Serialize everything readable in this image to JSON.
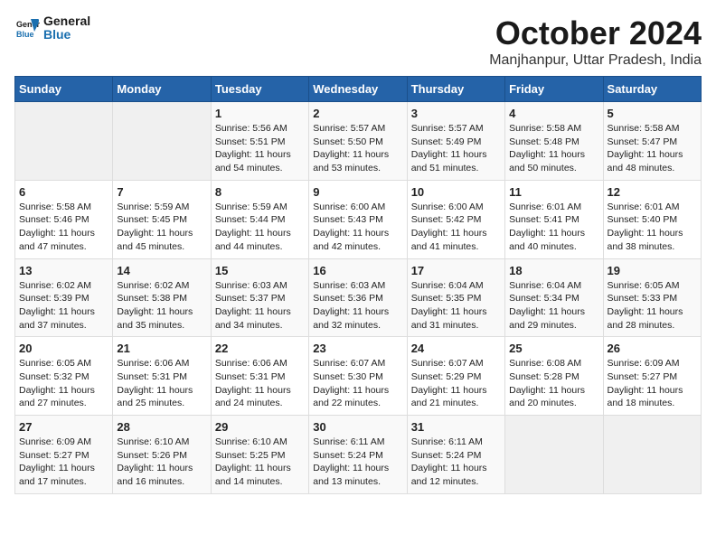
{
  "logo": {
    "line1": "General",
    "line2": "Blue"
  },
  "title": "October 2024",
  "subtitle": "Manjhanpur, Uttar Pradesh, India",
  "days_of_week": [
    "Sunday",
    "Monday",
    "Tuesday",
    "Wednesday",
    "Thursday",
    "Friday",
    "Saturday"
  ],
  "weeks": [
    [
      {
        "day": "",
        "content": ""
      },
      {
        "day": "",
        "content": ""
      },
      {
        "day": "1",
        "content": "Sunrise: 5:56 AM\nSunset: 5:51 PM\nDaylight: 11 hours\nand 54 minutes."
      },
      {
        "day": "2",
        "content": "Sunrise: 5:57 AM\nSunset: 5:50 PM\nDaylight: 11 hours\nand 53 minutes."
      },
      {
        "day": "3",
        "content": "Sunrise: 5:57 AM\nSunset: 5:49 PM\nDaylight: 11 hours\nand 51 minutes."
      },
      {
        "day": "4",
        "content": "Sunrise: 5:58 AM\nSunset: 5:48 PM\nDaylight: 11 hours\nand 50 minutes."
      },
      {
        "day": "5",
        "content": "Sunrise: 5:58 AM\nSunset: 5:47 PM\nDaylight: 11 hours\nand 48 minutes."
      }
    ],
    [
      {
        "day": "6",
        "content": "Sunrise: 5:58 AM\nSunset: 5:46 PM\nDaylight: 11 hours\nand 47 minutes."
      },
      {
        "day": "7",
        "content": "Sunrise: 5:59 AM\nSunset: 5:45 PM\nDaylight: 11 hours\nand 45 minutes."
      },
      {
        "day": "8",
        "content": "Sunrise: 5:59 AM\nSunset: 5:44 PM\nDaylight: 11 hours\nand 44 minutes."
      },
      {
        "day": "9",
        "content": "Sunrise: 6:00 AM\nSunset: 5:43 PM\nDaylight: 11 hours\nand 42 minutes."
      },
      {
        "day": "10",
        "content": "Sunrise: 6:00 AM\nSunset: 5:42 PM\nDaylight: 11 hours\nand 41 minutes."
      },
      {
        "day": "11",
        "content": "Sunrise: 6:01 AM\nSunset: 5:41 PM\nDaylight: 11 hours\nand 40 minutes."
      },
      {
        "day": "12",
        "content": "Sunrise: 6:01 AM\nSunset: 5:40 PM\nDaylight: 11 hours\nand 38 minutes."
      }
    ],
    [
      {
        "day": "13",
        "content": "Sunrise: 6:02 AM\nSunset: 5:39 PM\nDaylight: 11 hours\nand 37 minutes."
      },
      {
        "day": "14",
        "content": "Sunrise: 6:02 AM\nSunset: 5:38 PM\nDaylight: 11 hours\nand 35 minutes."
      },
      {
        "day": "15",
        "content": "Sunrise: 6:03 AM\nSunset: 5:37 PM\nDaylight: 11 hours\nand 34 minutes."
      },
      {
        "day": "16",
        "content": "Sunrise: 6:03 AM\nSunset: 5:36 PM\nDaylight: 11 hours\nand 32 minutes."
      },
      {
        "day": "17",
        "content": "Sunrise: 6:04 AM\nSunset: 5:35 PM\nDaylight: 11 hours\nand 31 minutes."
      },
      {
        "day": "18",
        "content": "Sunrise: 6:04 AM\nSunset: 5:34 PM\nDaylight: 11 hours\nand 29 minutes."
      },
      {
        "day": "19",
        "content": "Sunrise: 6:05 AM\nSunset: 5:33 PM\nDaylight: 11 hours\nand 28 minutes."
      }
    ],
    [
      {
        "day": "20",
        "content": "Sunrise: 6:05 AM\nSunset: 5:32 PM\nDaylight: 11 hours\nand 27 minutes."
      },
      {
        "day": "21",
        "content": "Sunrise: 6:06 AM\nSunset: 5:31 PM\nDaylight: 11 hours\nand 25 minutes."
      },
      {
        "day": "22",
        "content": "Sunrise: 6:06 AM\nSunset: 5:31 PM\nDaylight: 11 hours\nand 24 minutes."
      },
      {
        "day": "23",
        "content": "Sunrise: 6:07 AM\nSunset: 5:30 PM\nDaylight: 11 hours\nand 22 minutes."
      },
      {
        "day": "24",
        "content": "Sunrise: 6:07 AM\nSunset: 5:29 PM\nDaylight: 11 hours\nand 21 minutes."
      },
      {
        "day": "25",
        "content": "Sunrise: 6:08 AM\nSunset: 5:28 PM\nDaylight: 11 hours\nand 20 minutes."
      },
      {
        "day": "26",
        "content": "Sunrise: 6:09 AM\nSunset: 5:27 PM\nDaylight: 11 hours\nand 18 minutes."
      }
    ],
    [
      {
        "day": "27",
        "content": "Sunrise: 6:09 AM\nSunset: 5:27 PM\nDaylight: 11 hours\nand 17 minutes."
      },
      {
        "day": "28",
        "content": "Sunrise: 6:10 AM\nSunset: 5:26 PM\nDaylight: 11 hours\nand 16 minutes."
      },
      {
        "day": "29",
        "content": "Sunrise: 6:10 AM\nSunset: 5:25 PM\nDaylight: 11 hours\nand 14 minutes."
      },
      {
        "day": "30",
        "content": "Sunrise: 6:11 AM\nSunset: 5:24 PM\nDaylight: 11 hours\nand 13 minutes."
      },
      {
        "day": "31",
        "content": "Sunrise: 6:11 AM\nSunset: 5:24 PM\nDaylight: 11 hours\nand 12 minutes."
      },
      {
        "day": "",
        "content": ""
      },
      {
        "day": "",
        "content": ""
      }
    ]
  ]
}
